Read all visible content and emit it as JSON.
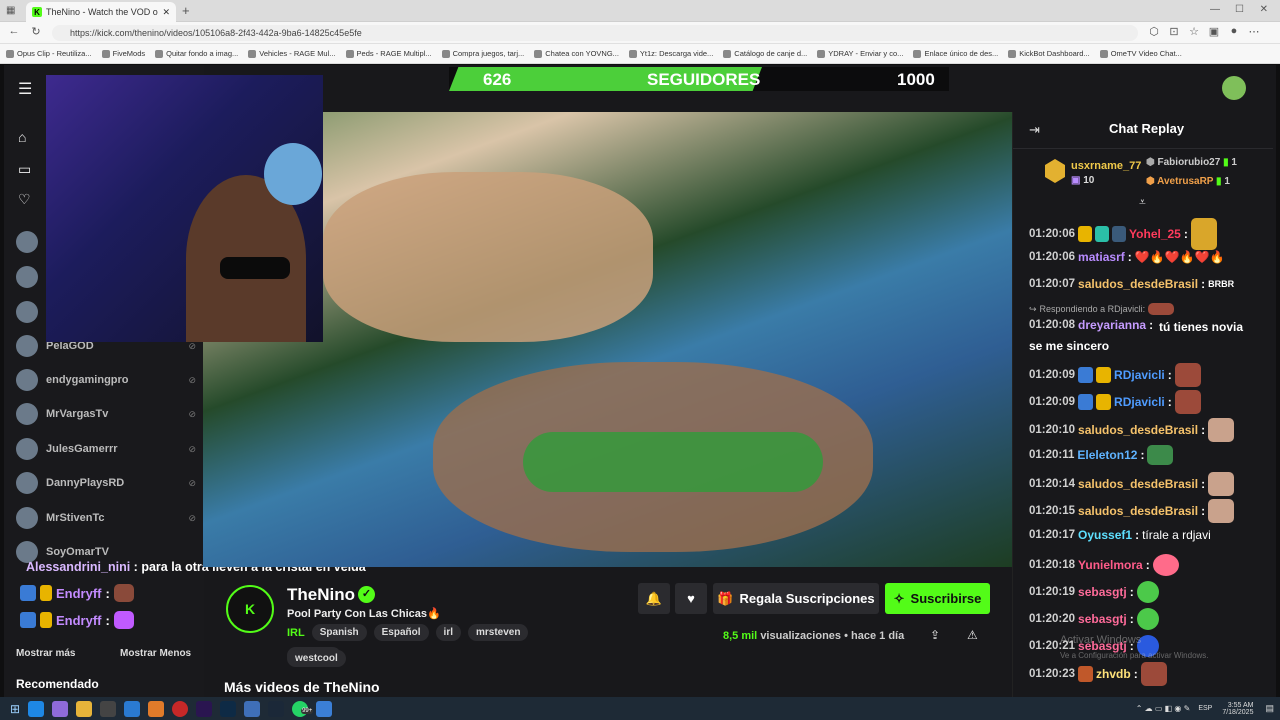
{
  "browser": {
    "tab_title": "TheNino - Watch the VOD o",
    "tab_favicon": "K",
    "url": "https://kick.com/thenino/videos/105106a8-2f43-442a-9ba6-14825c45e5fe",
    "bookmarks": [
      "Opus Clip - Reutiliza...",
      "FiveMods",
      "Quitar fondo a imag...",
      "Vehicles - RAGE Mul...",
      "Peds - RAGE Multipl...",
      "Compra juegos, tarj...",
      "Chatea con YOVNG...",
      "Yt1z: Descarga vide...",
      "Catálogo de canje d...",
      "YDRAY - Enviar y co...",
      "Enlace único de des...",
      "KickBot Dashboard...",
      "OmeTV Video Chat..."
    ]
  },
  "goal": {
    "current": "626",
    "label": "SEGUIDORES",
    "target": "1000",
    "progress": 0.626
  },
  "sidebar": {
    "follows": [
      "PelaGOD",
      "endygamingpro",
      "MrVargasTv",
      "JulesGamerrr",
      "DannyPlaysRD",
      "MrStivenTc",
      "SoyOmarTV"
    ],
    "show_more": "Mostrar más",
    "show_less": "Mostrar Menos",
    "recommended": "Recomendado"
  },
  "overlay_chat": [
    {
      "user": "Alessandrini_nini",
      "msg": "para la otra lleven a la cristal en velda"
    },
    {
      "user": "Endryff",
      "msg": ""
    },
    {
      "user": "Endryff",
      "msg": ""
    }
  ],
  "channel": {
    "name": "TheNino",
    "title": "Pool Party Con Las Chicas🔥",
    "category": "IRL",
    "tags": [
      "Spanish",
      "Español",
      "irl",
      "mrsteven",
      "spanish",
      "westcool"
    ],
    "gift_label": "Regala Suscripciones",
    "subscribe_label": "Suscribirse",
    "views_count": "8,5 mil",
    "views_label": "visualizaciones",
    "age": "hace 1 día",
    "more_videos": "Más videos de TheNino"
  },
  "chat": {
    "header": "Chat Replay",
    "top_gifters": [
      {
        "name": "usxrname_77",
        "count": "10"
      },
      {
        "name": "Fabiorubio27",
        "count": "1"
      },
      {
        "name": "AvetrusaRP",
        "count": "1"
      }
    ],
    "messages": [
      {
        "ts": "01:20:06",
        "user": "Yohel_25",
        "color": "#ff3b5c",
        "msg": ""
      },
      {
        "ts": "01:20:06",
        "user": "matiasrf",
        "color": "#b98cff",
        "msg": "❤️🔥❤️🔥❤️🔥"
      },
      {
        "ts": "01:20:07",
        "user": "saludos_desdeBrasil",
        "color": "#f5c26b",
        "msg": "BRBR"
      },
      {
        "ts": "01:20:08",
        "user": "dreyarianna",
        "color": "#c69cff",
        "msg": "tú tienes novia se me sincero",
        "reply": "Respondiendo a RDjavicli:"
      },
      {
        "ts": "01:20:09",
        "user": "RDjavicli",
        "color": "#4f9cff",
        "msg": ""
      },
      {
        "ts": "01:20:09",
        "user": "RDjavicli",
        "color": "#4f9cff",
        "msg": ""
      },
      {
        "ts": "01:20:10",
        "user": "saludos_desdeBrasil",
        "color": "#f5c26b",
        "msg": ""
      },
      {
        "ts": "01:20:11",
        "user": "Eleleton12",
        "color": "#5fb3ff",
        "msg": ""
      },
      {
        "ts": "01:20:14",
        "user": "saludos_desdeBrasil",
        "color": "#f5c26b",
        "msg": ""
      },
      {
        "ts": "01:20:15",
        "user": "saludos_desdeBrasil",
        "color": "#f5c26b",
        "msg": ""
      },
      {
        "ts": "01:20:17",
        "user": "Oyussef1",
        "color": "#5ee0ff",
        "msg": "tírale a rdjavi"
      },
      {
        "ts": "01:20:18",
        "user": "Yunielmora",
        "color": "#ff5c8a",
        "msg": ""
      },
      {
        "ts": "01:20:19",
        "user": "sebasgtj",
        "color": "#ff6b9a",
        "msg": ""
      },
      {
        "ts": "01:20:20",
        "user": "sebasgtj",
        "color": "#ff6b9a",
        "msg": ""
      },
      {
        "ts": "01:20:21",
        "user": "sebasgtj",
        "color": "#ff6b9a",
        "msg": ""
      },
      {
        "ts": "01:20:23",
        "user": "zhvdb",
        "color": "#ffe27a",
        "msg": ""
      }
    ]
  },
  "watermark": {
    "line1": "Activar Windows",
    "line2": "Ve a Configuración para activar Windows."
  },
  "taskbar": {
    "lang": "ESP",
    "time": "3:55 AM",
    "date": "7/18/2025",
    "badge": "99+"
  }
}
